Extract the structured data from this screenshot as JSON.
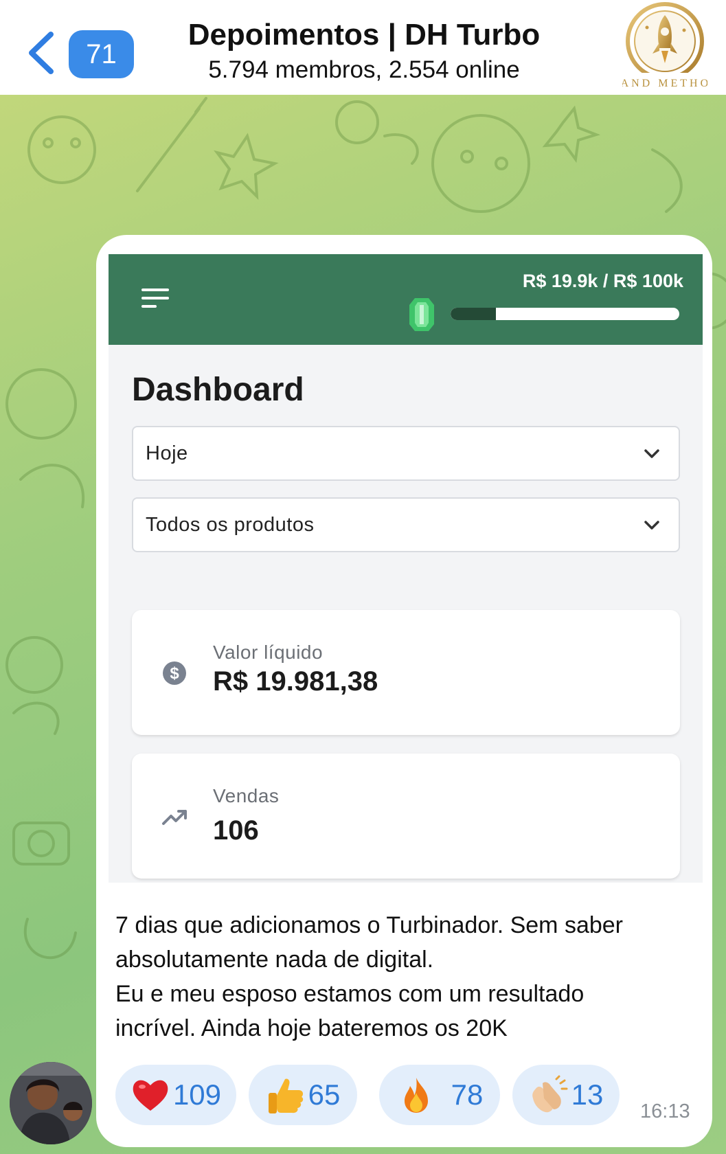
{
  "header": {
    "unread_count": "71",
    "title": "Depoimentos | DH Turbo",
    "subtitle": "5.794 membros, 2.554 online",
    "logo_text": "MAND METHOD"
  },
  "dashboard": {
    "goal_text": "R$ 19.9k / R$ 100k",
    "goal_progress": 0.199,
    "title": "Dashboard",
    "period_select": "Hoje",
    "product_select": "Todos os produtos",
    "net_value_label": "Valor líquido",
    "net_value": "R$ 19.981,38",
    "sales_label": "Vendas",
    "sales_value": "106"
  },
  "message": {
    "line1": "7 dias que adicionamos o Turbinador. Sem saber",
    "line2": "absolutamente nada de digital.",
    "line3": "Eu e meu esposo estamos com um resultado",
    "line4": "incrível. Ainda hoje bateremos os 20K",
    "time": "16:13"
  },
  "reactions": [
    {
      "icon": "heart-icon",
      "count": "109"
    },
    {
      "icon": "thumbs-up-icon",
      "count": "65"
    },
    {
      "icon": "fire-icon",
      "count": "78"
    },
    {
      "icon": "clapping-hands-icon",
      "count": "13"
    }
  ],
  "colors": {
    "app_header": "#3a7a5a",
    "accent_blue": "#3a8be8",
    "reaction_bg": "#e3eefb"
  }
}
